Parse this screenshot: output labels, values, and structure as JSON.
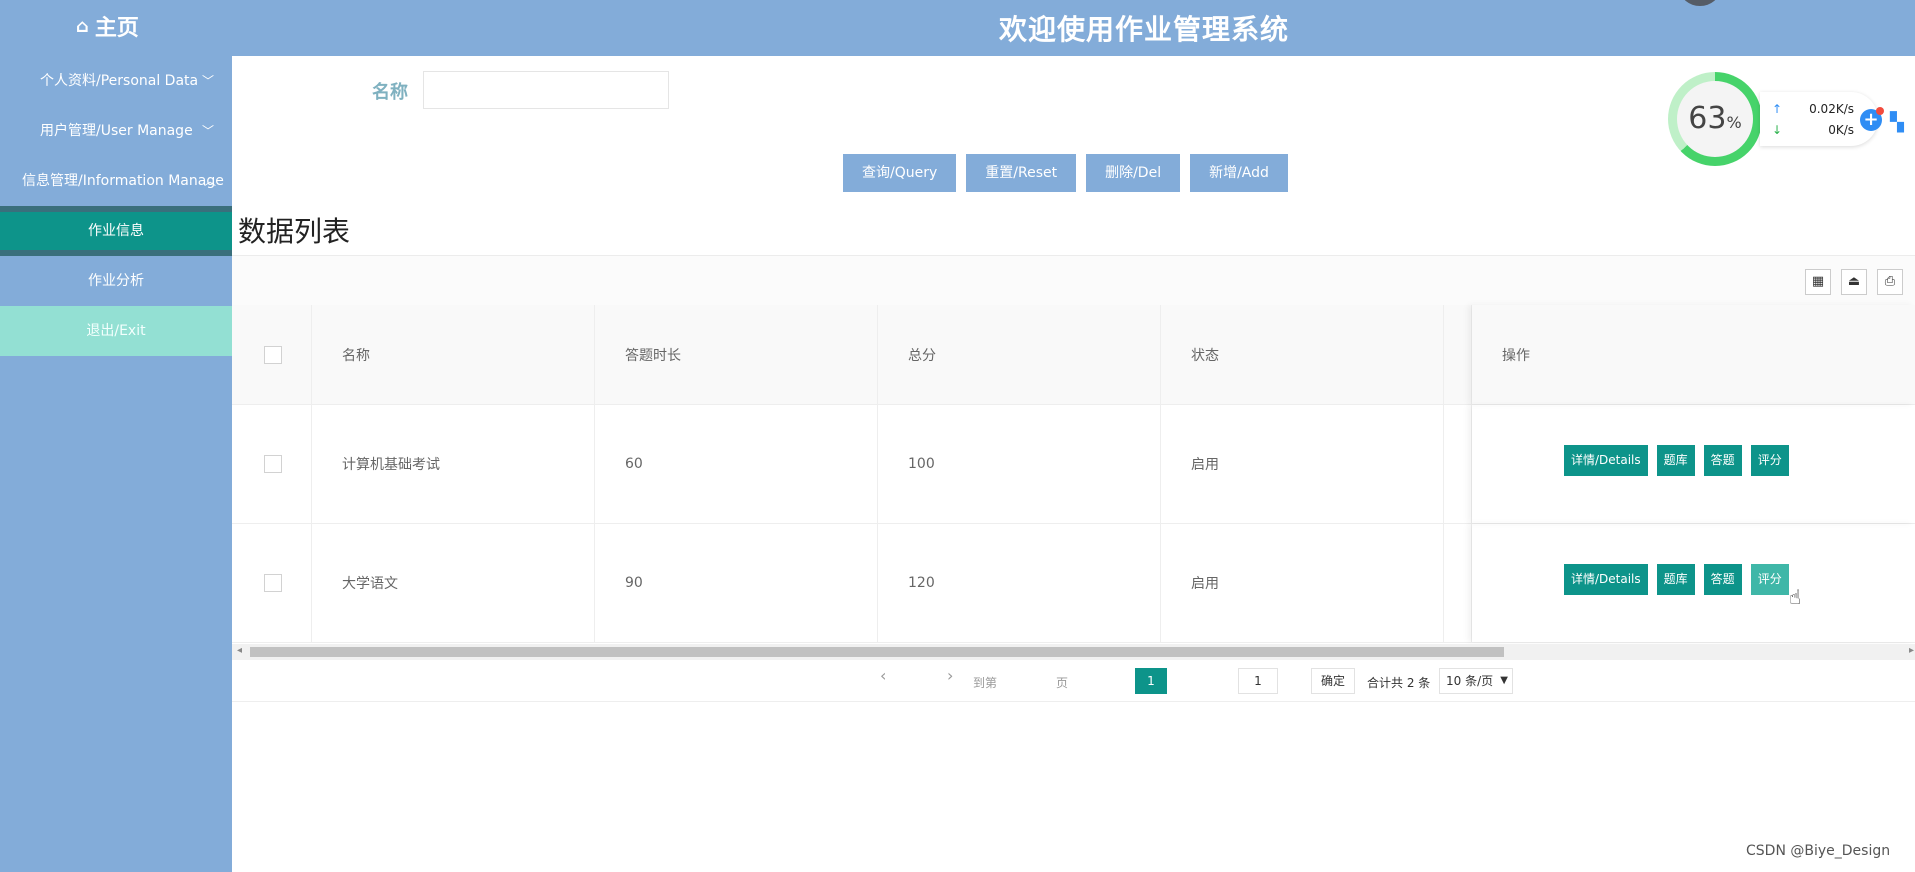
{
  "header": {
    "home_label": "主页",
    "title": "欢迎使用作业管理系统"
  },
  "sidebar": {
    "items": [
      {
        "label": "个人资料/Personal Data"
      },
      {
        "label": "用户管理/User Manage"
      },
      {
        "label": "信息管理/Information Manage"
      }
    ],
    "sub_items": [
      {
        "label": "作业信息",
        "active": true
      },
      {
        "label": "作业分析"
      },
      {
        "label": "退出/Exit"
      }
    ]
  },
  "search": {
    "label": "名称",
    "value": ""
  },
  "actions": {
    "query": "查询/Query",
    "reset": "重置/Reset",
    "delete": "删除/Del",
    "add": "新增/Add"
  },
  "list_title": "数据列表",
  "table": {
    "headers": [
      "名称",
      "答题时长",
      "总分",
      "状态",
      "操作"
    ],
    "rows": [
      {
        "name": "计算机基础考试",
        "duration": "60",
        "score": "100",
        "status": "启用"
      },
      {
        "name": "大学语文",
        "duration": "90",
        "score": "120",
        "status": "启用"
      }
    ],
    "row_actions": [
      "详情/Details",
      "题库",
      "答题",
      "评分"
    ]
  },
  "pagination": {
    "current_page": "1",
    "goto_label": "到第",
    "goto_value": "1",
    "page_unit": "页",
    "confirm": "确定",
    "total": "合计共 2 条",
    "page_size": "10 条/页"
  },
  "network_widget": {
    "percent": "63",
    "percent_unit": "%",
    "upload": "0.02K/s",
    "download": "0K/s"
  },
  "watermark": "CSDN @Biye_Design",
  "colors": {
    "primary": "#83acd9",
    "accent": "#0d948a",
    "exit_bg": "#93e0d3"
  }
}
